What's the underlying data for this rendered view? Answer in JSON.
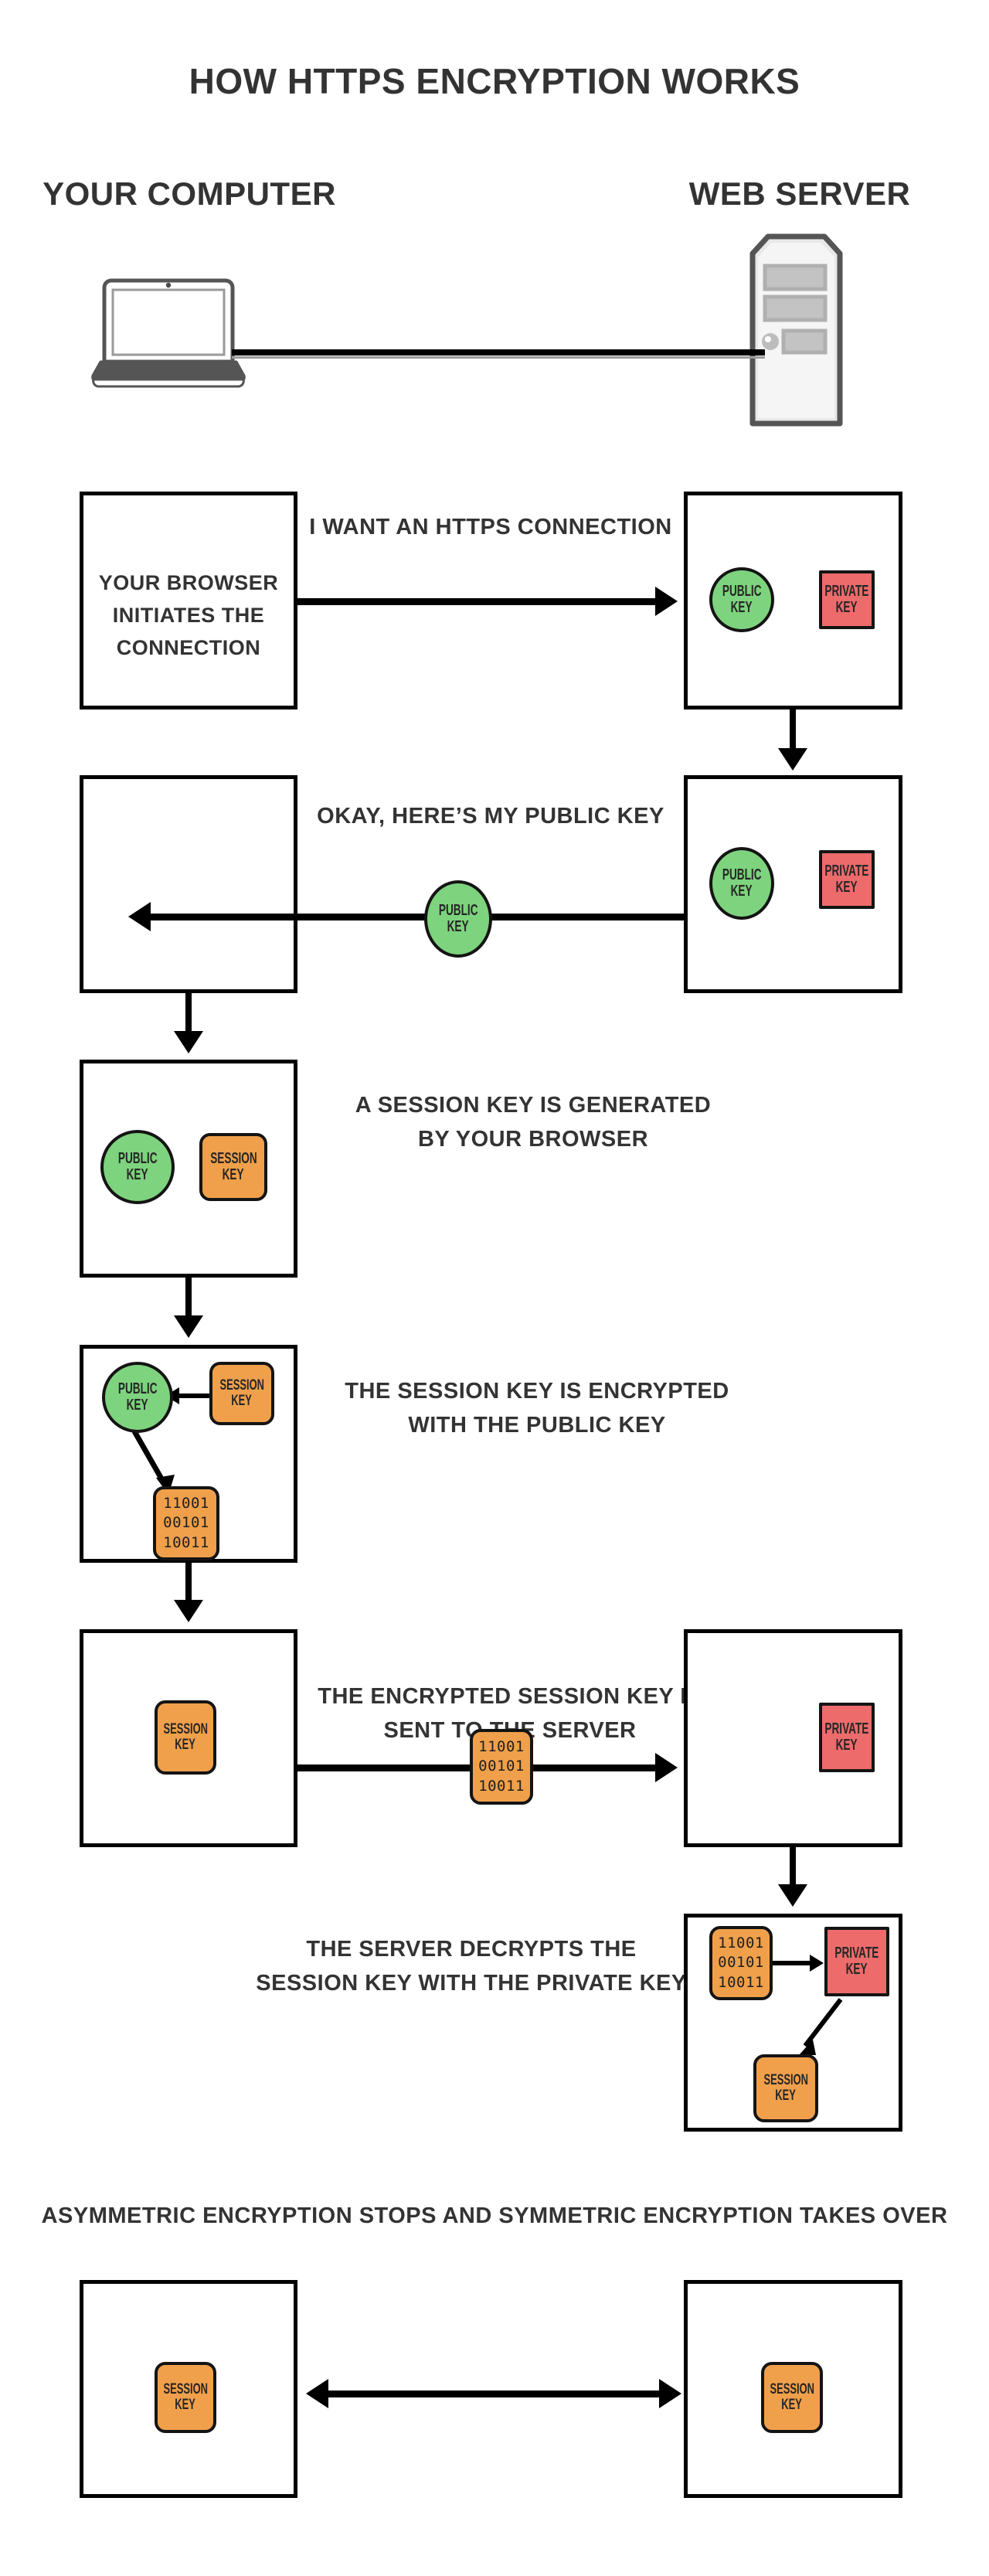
{
  "title": "HOW HTTPS ENCRYPTION WORKS",
  "columns": {
    "client_label": "YOUR COMPUTER",
    "server_label": "WEB SERVER",
    "client_icon": "laptop-icon",
    "server_icon": "server-tower-icon"
  },
  "tokens": {
    "public_key": {
      "line1": "PUBLIC",
      "line2": "KEY",
      "color": "#7ED37E",
      "shape": "circle"
    },
    "private_key": {
      "line1": "PRIVATE",
      "line2": "KEY",
      "color": "#EE6B6B",
      "shape": "rectangle"
    },
    "session_key": {
      "line1": "SESSION",
      "line2": "KEY",
      "color": "#F0A04B",
      "shape": "rounded-rectangle"
    },
    "encrypted": {
      "line1": "11001",
      "line2": "00101",
      "line3": "10011",
      "color": "#F0A04B",
      "shape": "rounded-rectangle"
    }
  },
  "steps": [
    {
      "id": "step1",
      "caption": "I WANT AN HTTPS CONNECTION",
      "client_contents": "YOUR BROWSER INITIATES THE CONNECTION",
      "client_text_lines": [
        "YOUR BROWSER",
        "INITIATES THE",
        "CONNECTION"
      ],
      "direction": "client-to-server",
      "server_tokens": [
        "public_key",
        "private_key"
      ]
    },
    {
      "id": "step2",
      "caption": "OKAY, HERE’S MY PUBLIC KEY",
      "direction": "server-to-client",
      "payload": "public_key",
      "server_tokens": [
        "public_key",
        "private_key"
      ]
    },
    {
      "id": "step3",
      "caption_lines": [
        "A SESSION KEY IS GENERATED",
        "BY YOUR BROWSER"
      ],
      "client_tokens": [
        "public_key",
        "session_key"
      ]
    },
    {
      "id": "step4",
      "caption_lines": [
        "THE SESSION KEY IS ENCRYPTED",
        "WITH THE PUBLIC KEY"
      ],
      "client_tokens": [
        "public_key",
        "session_key",
        "encrypted"
      ]
    },
    {
      "id": "step5",
      "caption_lines": [
        "THE ENCRYPTED SESSION KEY IS",
        "SENT TO THE SERVER"
      ],
      "direction": "client-to-server",
      "payload": "encrypted",
      "client_tokens": [
        "session_key"
      ],
      "server_tokens": [
        "private_key"
      ]
    },
    {
      "id": "step6",
      "caption_lines": [
        "THE SERVER DECRYPTS THE",
        "SESSION KEY WITH THE PRIVATE KEY"
      ],
      "server_tokens": [
        "encrypted",
        "private_key",
        "session_key"
      ]
    }
  ],
  "footer": {
    "caption": "ASYMMETRIC ENCRYPTION STOPS AND SYMMETRIC ENCRYPTION TAKES OVER",
    "direction": "bidirectional",
    "client_tokens": [
      "session_key"
    ],
    "server_tokens": [
      "session_key"
    ]
  },
  "colors": {
    "ink": "#000000",
    "text": "#333333",
    "green": "#7ED37E",
    "red": "#EE6B6B",
    "orange": "#F0A04B",
    "device_gray": "#555555",
    "background": "#ffffff"
  }
}
